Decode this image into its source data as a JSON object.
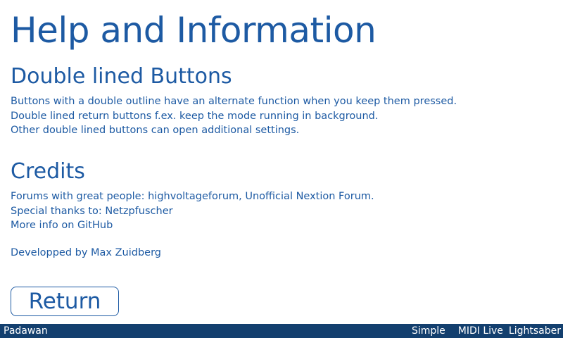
{
  "page": {
    "title": "Help and Information"
  },
  "sections": {
    "double_lined": {
      "heading": "Double lined Buttons",
      "lines": [
        "Buttons with a double outline have an alternate function when you keep them pressed.",
        "Double lined return buttons f.ex. keep the mode running in background.",
        "Other double lined buttons can open additional settings."
      ]
    },
    "credits": {
      "heading": "Credits",
      "lines": [
        "Forums with great people: highvoltageforum, Unofficial Nextion Forum.",
        "Special thanks to: Netzpfuscher",
        "More info on GitHub"
      ],
      "developer": "Developped by Max Zuidberg"
    }
  },
  "buttons": {
    "return_label": "Return"
  },
  "status_bar": {
    "left": "Padawan",
    "modes": [
      "Simple",
      "MIDI Live",
      "Lightsaber"
    ]
  },
  "colors": {
    "text": "#1d5aa3",
    "status_bar_bg": "#133f6e",
    "status_bar_text": "#ffffff",
    "background": "#ffffff"
  }
}
